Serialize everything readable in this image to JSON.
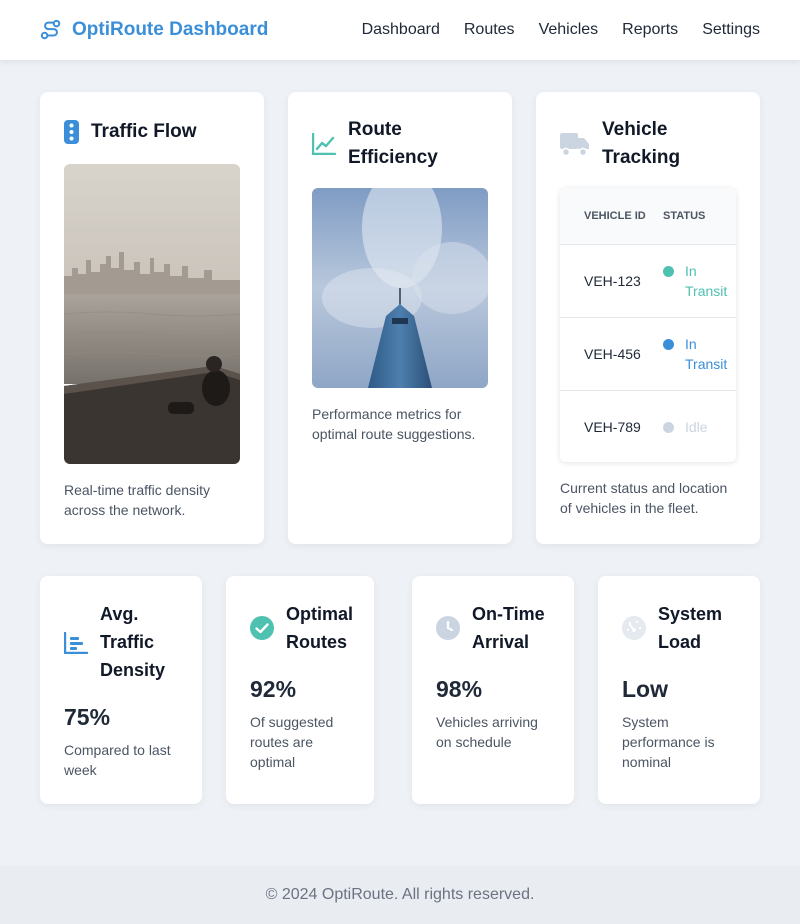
{
  "header": {
    "title": "OptiRoute Dashboard",
    "brand_icon": "route-icon",
    "nav": [
      "Dashboard",
      "Routes",
      "Vehicles",
      "Reports",
      "Settings"
    ]
  },
  "cards": {
    "traffic": {
      "title": "Traffic Flow",
      "icon": "traffic-light-icon",
      "image": "city skyline over water with person seated on pier",
      "description": "Real-time traffic density across the network."
    },
    "efficiency": {
      "title": "Route Efficiency",
      "icon": "line-chart-icon",
      "image": "skyscraper against cloudy sky",
      "description": "Performance metrics for optimal route suggestions."
    },
    "tracking": {
      "title": "Vehicle Tracking",
      "icon": "truck-icon",
      "table": {
        "headers": [
          "VEHICLE ID",
          "STATUS"
        ],
        "rows": [
          {
            "id": "VEH-123",
            "status": "In Transit",
            "color": "#4fc1b0"
          },
          {
            "id": "VEH-456",
            "status": "In Transit",
            "color": "#3b8fd9"
          },
          {
            "id": "VEH-789",
            "status": "Idle",
            "color": "#cbd5e1"
          }
        ]
      },
      "description": "Current status and location of vehicles in the fleet."
    }
  },
  "stats": [
    {
      "title": "Avg. Traffic Density",
      "value": "75%",
      "note": "Compared to last week",
      "icon": "bar-chart-icon"
    },
    {
      "title": "Optimal Routes",
      "value": "92%",
      "note": "Of suggested routes are optimal",
      "icon": "check-circle-icon"
    },
    {
      "title": "On-Time Arrival",
      "value": "98%",
      "note": "Vehicles arriving on schedule",
      "icon": "clock-icon"
    },
    {
      "title": "System Load",
      "value": "Low",
      "note": "System performance is nominal",
      "icon": "gauge-icon"
    }
  ],
  "colors": {
    "brand": "#3b8fd9",
    "teal": "#4fc1b0",
    "muted_icon": "#cbd5e1"
  },
  "footer": {
    "text": "© 2024 OptiRoute. All rights reserved."
  }
}
